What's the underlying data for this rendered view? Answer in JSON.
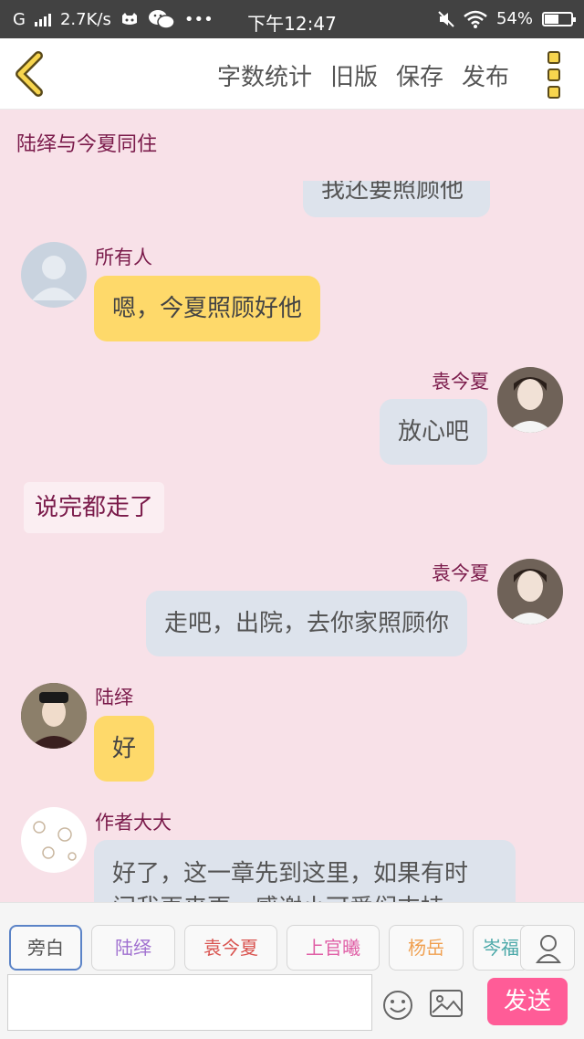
{
  "status_bar": {
    "network": "G",
    "speed": "2.7K/s",
    "time": "下午12:47",
    "battery_text": "54%",
    "battery_level": 0.54
  },
  "header": {
    "menu": [
      "字数统计",
      "旧版",
      "保存",
      "发布"
    ],
    "accent_color": "#f7d54e"
  },
  "chat": {
    "title": "陆绎与今夏同住",
    "partial_top_text": "我还要照顾他",
    "messages": [
      {
        "sender": "所有人",
        "text": "嗯，今夏照顾好他",
        "side": "left",
        "bubble": "yellow"
      },
      {
        "sender": "袁今夏",
        "text": "放心吧",
        "side": "right",
        "bubble": "grey"
      },
      {
        "narration": "说完都走了"
      },
      {
        "sender": "袁今夏",
        "text": "走吧，出院，去你家照顾你",
        "side": "right",
        "bubble": "grey"
      },
      {
        "sender": "陆绎",
        "text": "好",
        "side": "left",
        "bubble": "yellow"
      },
      {
        "sender": "作者大大",
        "text_line1": "好了，这一章先到这里，如果有时",
        "text_line2": "间我再来更，感谢小可爱们支持",
        "side": "left",
        "bubble": "grey"
      }
    ]
  },
  "toolbar": {
    "characters": [
      {
        "name": "旁白",
        "color": "#555555"
      },
      {
        "name": "陆绎",
        "color": "#a070d0"
      },
      {
        "name": "袁今夏",
        "color": "#d9534f"
      },
      {
        "name": "上官曦",
        "color": "#e05fa6"
      },
      {
        "name": "杨岳",
        "color": "#f0a050"
      },
      {
        "name": "岑福",
        "color": "#4aa8a8"
      }
    ],
    "input_placeholder": "",
    "send_label": "发送",
    "send_color": "#ff5c97"
  }
}
